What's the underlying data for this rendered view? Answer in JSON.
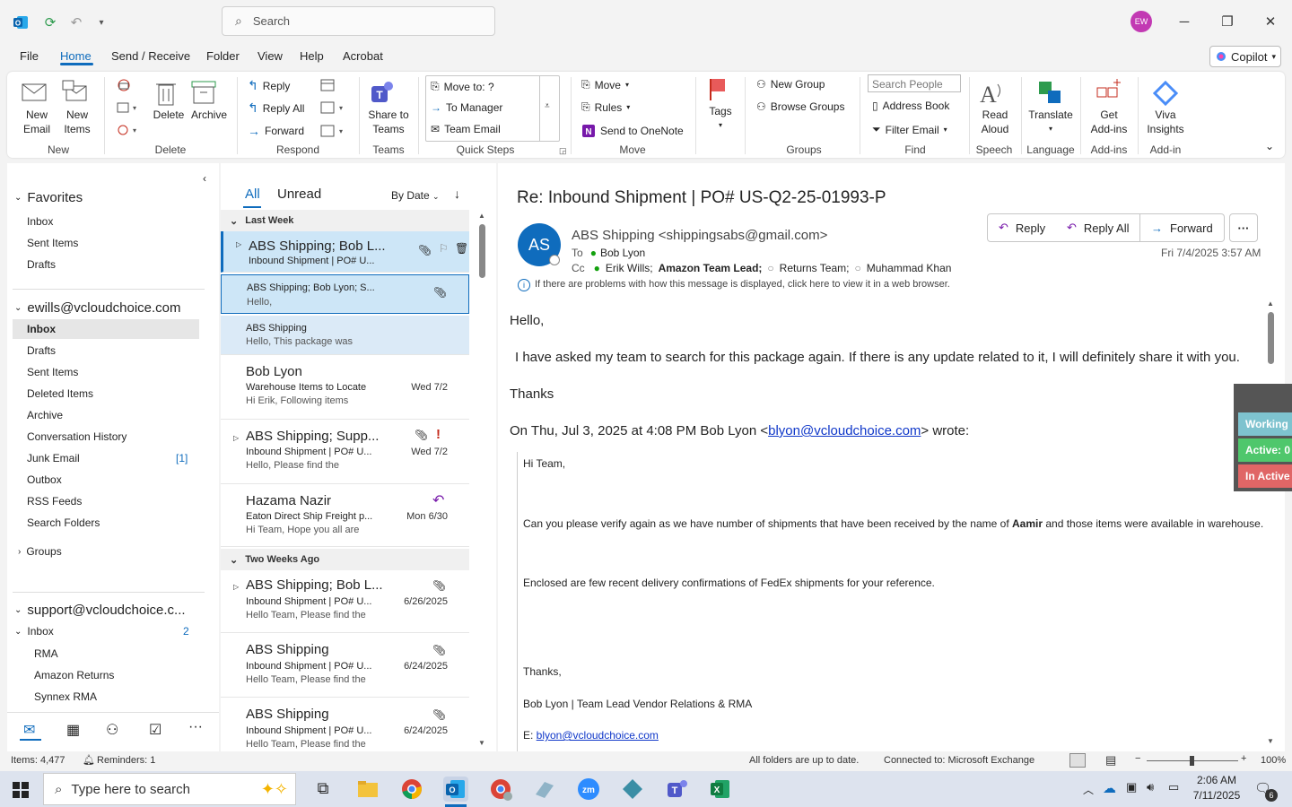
{
  "window": {
    "search_placeholder": "Search",
    "avatar_initials": "EW"
  },
  "menu": [
    "File",
    "Home",
    "Send / Receive",
    "Folder",
    "View",
    "Help",
    "Acrobat"
  ],
  "copilot_label": "Copilot",
  "ribbon": {
    "new_email": "New\nEmail",
    "new_items": "New\nItems",
    "delete": "Delete",
    "archive": "Archive",
    "reply": "Reply",
    "reply_all": "Reply All",
    "forward": "Forward",
    "share_teams": "Share to\nTeams",
    "qs_move_to": "Move to: ?",
    "qs_to_manager": "To Manager",
    "qs_team_email": "Team Email",
    "move": "Move",
    "rules": "Rules",
    "send_onenote": "Send to OneNote",
    "tags": "Tags",
    "new_group": "New Group",
    "browse_groups": "Browse Groups",
    "search_people": "Search People",
    "address_book": "Address Book",
    "filter_email": "Filter Email",
    "read_aloud": "Read\nAloud",
    "translate": "Translate",
    "get_addins": "Get\nAdd-ins",
    "viva": "Viva\nInsights",
    "groups": [
      "New",
      "Delete",
      "Respond",
      "Teams",
      "Quick Steps",
      "Move",
      "Groups",
      "Find",
      "Speech",
      "Language",
      "Add-ins",
      "Add-in"
    ]
  },
  "folders": {
    "favorites_title": "Favorites",
    "favorites": [
      "Inbox",
      "Sent Items",
      "Drafts"
    ],
    "account1": "ewills@vcloudchoice.com",
    "account1_items": [
      "Inbox",
      "Drafts",
      "Sent Items",
      "Deleted Items",
      "Archive",
      "Conversation History",
      "Junk Email",
      "Outbox",
      "RSS Feeds",
      "Search Folders"
    ],
    "junk_count": "[1]",
    "groups": "Groups",
    "account2": "support@vcloudchoice.c...",
    "account2_inbox": "Inbox",
    "account2_inbox_count": "2",
    "account2_items": [
      "RMA",
      "Amazon Returns",
      "Synnex RMA"
    ]
  },
  "list": {
    "tab_all": "All",
    "tab_unread": "Unread",
    "sort": "By Date",
    "group1": "Last Week",
    "group2": "Two Weeks Ago",
    "messages": [
      {
        "sender": "ABS Shipping;  Bob L...",
        "subject": "Inbound Shipment | PO# U...",
        "preview": "",
        "date": ""
      },
      {
        "sender": "ABS Shipping;  Bob Lyon;  S...",
        "subject": "",
        "preview": "Hello,",
        "date": ""
      },
      {
        "sender": "ABS Shipping",
        "subject": "",
        "preview": "Hello,  This package was",
        "date": ""
      },
      {
        "sender": "Bob Lyon",
        "subject": "Warehouse Items to Locate",
        "preview": "Hi Erik,  Following items",
        "date": "Wed 7/2"
      },
      {
        "sender": "ABS Shipping;  Supp...",
        "subject": "Inbound Shipment | PO# U...",
        "preview": "Hello,  Please find the",
        "date": "Wed 7/2"
      },
      {
        "sender": "Hazama Nazir",
        "subject": "Eaton Direct Ship Freight p...",
        "preview": "Hi Team,  Hope you all are",
        "date": "Mon 6/30"
      },
      {
        "sender": "ABS Shipping;  Bob L...",
        "subject": "Inbound Shipment | PO# U...",
        "preview": "Hello Team,  Please find the",
        "date": "6/26/2025"
      },
      {
        "sender": "ABS Shipping",
        "subject": "Inbound Shipment | PO# U...",
        "preview": "Hello Team,  Please find the",
        "date": "6/24/2025"
      },
      {
        "sender": "ABS Shipping",
        "subject": "Inbound Shipment | PO# U...",
        "preview": "Hello Team,  Please find the",
        "date": "6/24/2025"
      }
    ]
  },
  "email": {
    "subject": "Re: Inbound Shipment | PO# US-Q2-25-01993-P",
    "avatar": "AS",
    "from": "ABS Shipping <shippingsabs@gmail.com>",
    "to_label": "To",
    "to": "Bob Lyon",
    "cc_label": "Cc",
    "cc1": "Erik Wills;",
    "cc2": "Amazon Team Lead;",
    "cc3": "Returns Team;",
    "cc4": "Muhammad Khan",
    "date": "Fri 7/4/2025 3:57 AM",
    "btn_reply": "Reply",
    "btn_reply_all": "Reply All",
    "btn_forward": "Forward",
    "info": "If there are problems with how this message is displayed, click here to view it in a web browser.",
    "greeting": "Hello,",
    "body1": "I have asked my team to search for this package again. If there is any update related to it, I will definitely share it with you.",
    "thanks": "Thanks",
    "quote_intro_a": "On Thu, Jul 3, 2025 at 4:08 PM Bob Lyon <",
    "quote_link": "blyon@vcloudchoice.com",
    "quote_intro_b": "> wrote:",
    "q_hi": "Hi Team,",
    "q_line1a": "Can you please verify again as we have number of shipments that have been received by the name of ",
    "q_line1b": "Aamir",
    "q_line1c": " and those items were available in warehouse.",
    "q_line2": "Enclosed are few recent delivery confirmations of FedEx shipments for your reference.",
    "q_thanks": "Thanks,",
    "q_sig": "Bob Lyon | Team Lead Vendor Relations & RMA",
    "q_email_label": "E: ",
    "q_email": "blyon@vcloudchoice.com"
  },
  "status_widget": {
    "working": "Working",
    "active": "Active: 0",
    "inactive": "In Active"
  },
  "statusbar": {
    "items": "Items: 4,477",
    "reminders": "Reminders: 1",
    "sync": "All folders are up to date.",
    "connected": "Connected to: Microsoft Exchange",
    "zoom": "100%"
  },
  "taskbar": {
    "search": "Type here to search",
    "time": "2:06 AM",
    "date": "7/11/2025",
    "notif": "6"
  }
}
